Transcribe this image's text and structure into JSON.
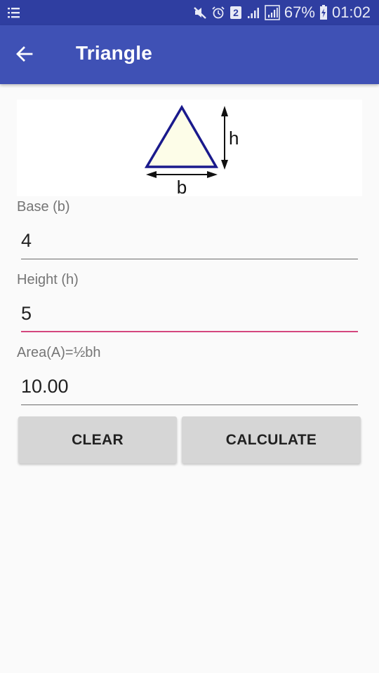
{
  "status_bar": {
    "notification_icon": "list-notification-icon",
    "icons": [
      "mute-icon",
      "alarm-icon",
      "sim-2-icon",
      "signal-icon",
      "signal-boxed-icon"
    ],
    "battery_percent": "67%",
    "battery_icon": "battery-charging-icon",
    "time": "01:02"
  },
  "toolbar": {
    "back_icon": "arrow-left-icon",
    "title": "Triangle"
  },
  "diagram": {
    "base_label": "b",
    "height_label": "h",
    "fill_color": "#fdfde8",
    "stroke_color": "#1a1a8c"
  },
  "form": {
    "base": {
      "label": "Base (b)",
      "value": "4"
    },
    "height": {
      "label": "Height (h)",
      "value": "5",
      "focused": true
    },
    "area": {
      "label": "Area(A)=½bh",
      "value": "10.00"
    }
  },
  "buttons": {
    "clear_label": "CLEAR",
    "calculate_label": "CALCULATE"
  },
  "colors": {
    "primary": "#3f51b5",
    "primary_dark": "#2f3ea1",
    "accent": "#d4467e"
  }
}
